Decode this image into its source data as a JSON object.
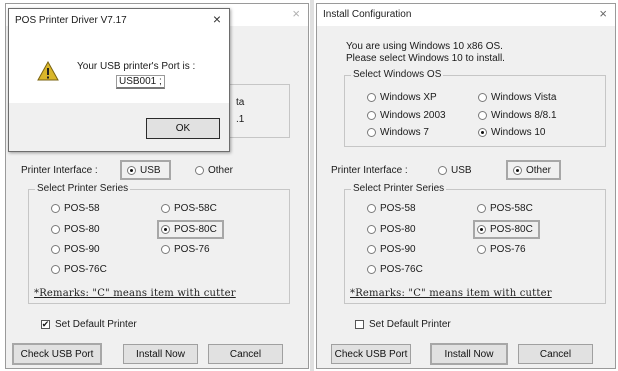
{
  "left_window": {
    "title_close": "×",
    "partial_os_text_1": "ta",
    "partial_os_text_2": ".1",
    "printer_interface_label": "Printer Interface :",
    "interface_usb": "USB",
    "interface_other": "Other",
    "selected_interface": "USB",
    "series_group_label": "Select Printer Series",
    "series": [
      "POS-58",
      "POS-58C",
      "POS-80",
      "POS-80C",
      "POS-90",
      "POS-76",
      "POS-76C"
    ],
    "selected_series": "POS-80C",
    "remarks": "*Remarks: \"C\" means item with cutter",
    "set_default_label": "Set Default Printer",
    "set_default_checked": true,
    "check_mark": "✔",
    "buttons": {
      "check_usb": "Check USB Port",
      "install": "Install Now",
      "cancel": "Cancel"
    }
  },
  "modal": {
    "title": "POS Printer Driver V7.17",
    "close": "×",
    "message_line1": "Your USB printer's Port is :",
    "port_value": "USB001 ;",
    "ok_label": "OK",
    "icon": "warning-icon"
  },
  "right_window": {
    "title": "Install Configuration",
    "close": "×",
    "os_info_line1": "You are using Windows 10 x86 OS.",
    "os_info_line2": "Please select Windows 10 to install.",
    "os_group_label": "Select Windows OS",
    "os_options": [
      "Windows XP",
      "Windows Vista",
      "Windows 2003",
      "Windows 8/8.1",
      "Windows 7",
      "Windows 10"
    ],
    "selected_os": "Windows 10",
    "printer_interface_label": "Printer Interface :",
    "interface_usb": "USB",
    "interface_other": "Other",
    "selected_interface": "Other",
    "series_group_label": "Select Printer Series",
    "series": [
      "POS-58",
      "POS-58C",
      "POS-80",
      "POS-80C",
      "POS-90",
      "POS-76",
      "POS-76C"
    ],
    "selected_series": "POS-80C",
    "remarks": "*Remarks: \"C\" means item with cutter",
    "set_default_label": "Set Default Printer",
    "set_default_checked": false,
    "buttons": {
      "check_usb": "Check USB Port",
      "install": "Install Now",
      "cancel": "Cancel"
    }
  }
}
